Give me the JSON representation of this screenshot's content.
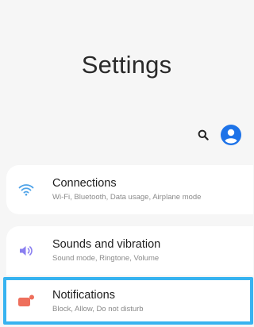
{
  "header": {
    "title": "Settings"
  },
  "toolbar": {
    "search_icon": "search-icon",
    "account_icon": "account-icon",
    "account_color": "#1e73e8"
  },
  "items": [
    {
      "title": "Connections",
      "subtitle": "Wi-Fi, Bluetooth, Data usage, Airplane mode",
      "icon": "wifi-icon",
      "icon_color": "#4fa3e8"
    },
    {
      "title": "Sounds and vibration",
      "subtitle": "Sound mode, Ringtone, Volume",
      "icon": "volume-icon",
      "icon_color": "#8a7ff0"
    },
    {
      "title": "Notifications",
      "subtitle": "Block, Allow, Do not disturb",
      "icon": "notification-icon",
      "icon_color": "#ee6f5c",
      "highlighted": true
    }
  ],
  "highlight_color": "#37b3f0"
}
